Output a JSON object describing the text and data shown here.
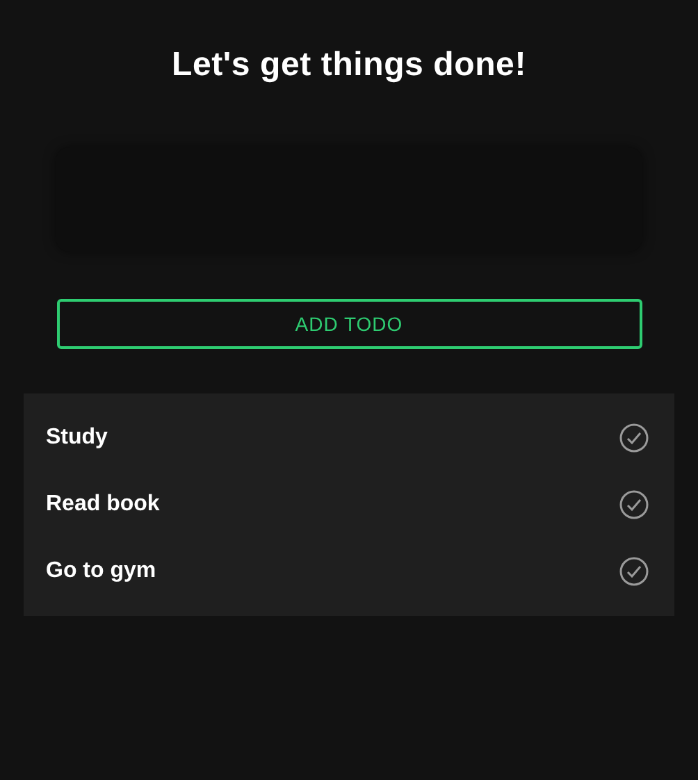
{
  "title": "Let's get things done!",
  "add_button": {
    "label": "ADD TODO"
  },
  "todos": [
    {
      "text": "Study"
    },
    {
      "text": "Read book"
    },
    {
      "text": "Go to gym"
    }
  ]
}
